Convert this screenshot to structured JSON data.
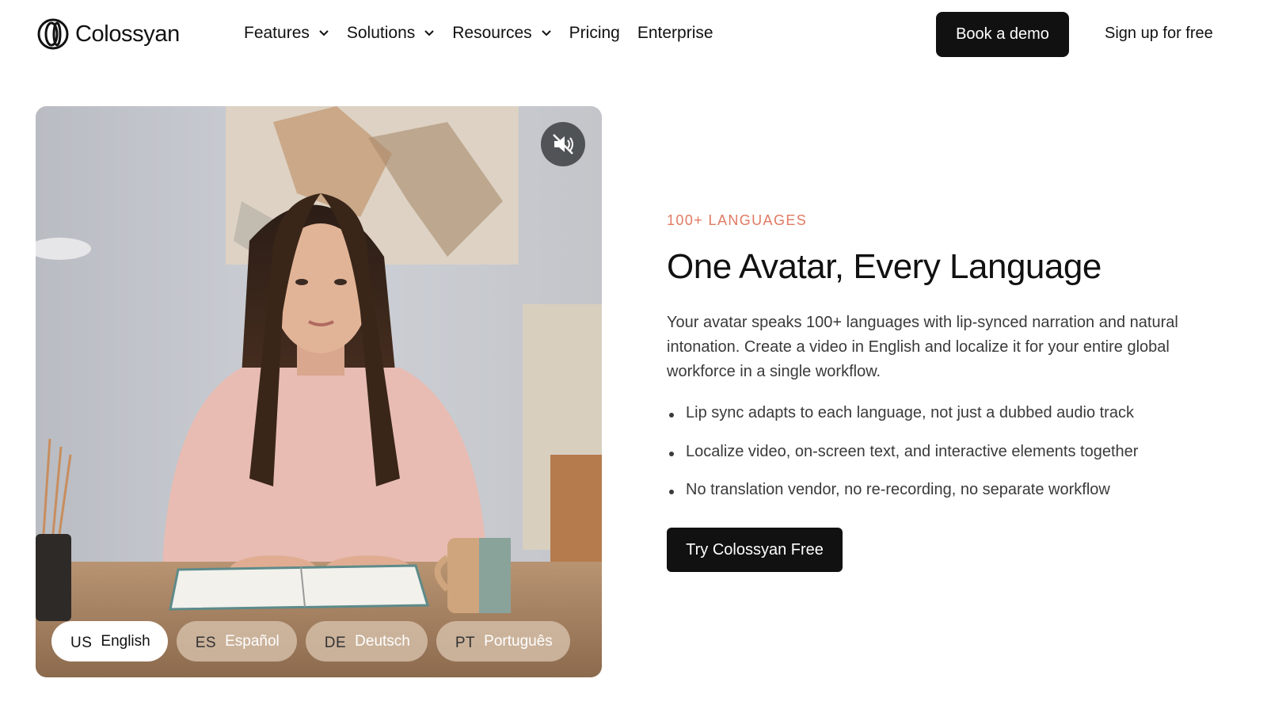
{
  "brand": {
    "name": "Colossyan"
  },
  "nav": {
    "items": [
      {
        "label": "Features",
        "has_dropdown": true
      },
      {
        "label": "Solutions",
        "has_dropdown": true
      },
      {
        "label": "Resources",
        "has_dropdown": true
      },
      {
        "label": "Pricing",
        "has_dropdown": false
      },
      {
        "label": "Enterprise",
        "has_dropdown": false
      }
    ],
    "book_demo_label": "Book a demo",
    "signup_label": "Sign up for free"
  },
  "video": {
    "mute_icon": "speaker-muted-icon",
    "languages": [
      {
        "code": "US",
        "label": "English",
        "active": true
      },
      {
        "code": "ES",
        "label": "Español",
        "active": false
      },
      {
        "code": "DE",
        "label": "Deutsch",
        "active": false
      },
      {
        "code": "PT",
        "label": "Português",
        "active": false
      }
    ]
  },
  "section": {
    "eyebrow": "100+ LANGUAGES",
    "headline": "One Avatar, Every Language",
    "description": "Your avatar speaks 100+ languages with lip-synced narration and natural intonation. Create a video in English and localize it for your entire global workforce in a single workflow.",
    "bullets": [
      "Lip sync adapts to each language, not just a dubbed audio track",
      "Localize video, on-screen text, and interactive elements together",
      "No translation vendor, no re-recording, no separate workflow"
    ],
    "cta_label": "Try Colossyan Free"
  },
  "colors": {
    "accent_eyebrow": "#e07a62",
    "button_dark": "#111111",
    "pill_inactive": "#d6c0aa",
    "pill_active": "#ffffff"
  }
}
